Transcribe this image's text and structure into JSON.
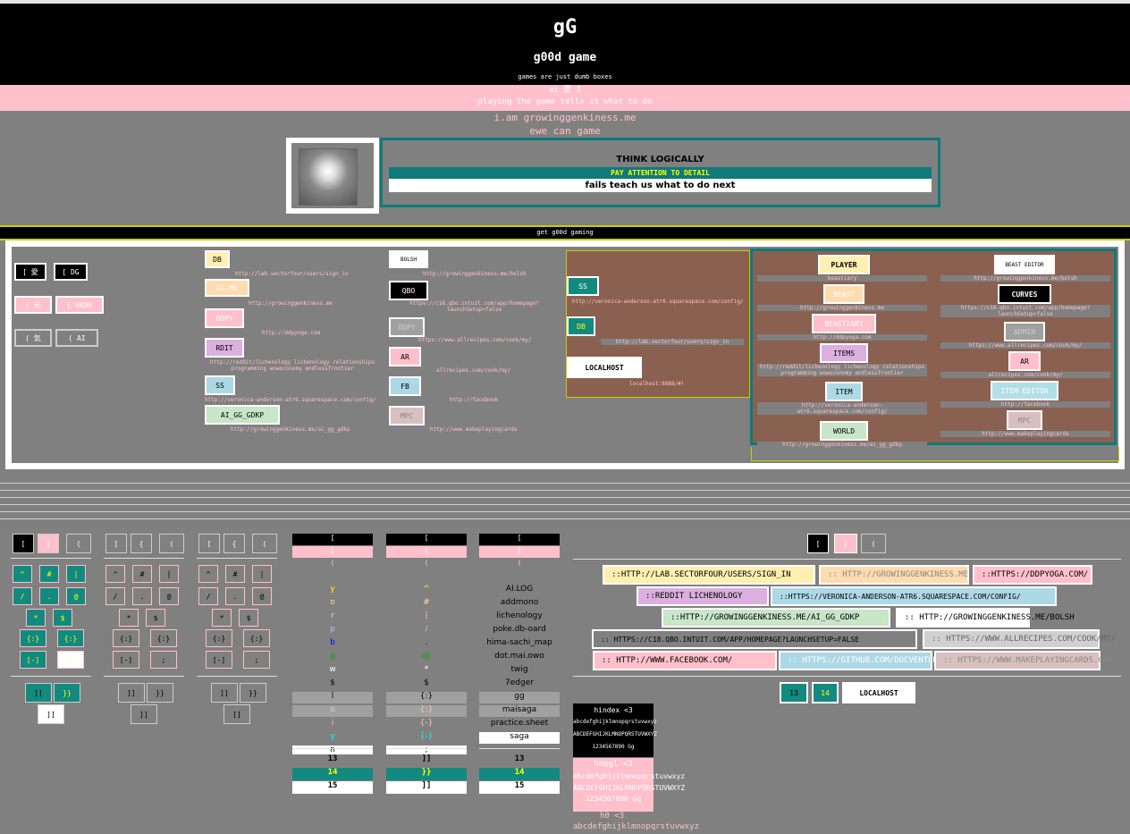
{
  "header": {
    "logo": "gG",
    "name": "g00d game",
    "tagline": "games are just dumb boxes"
  },
  "pinkband": {
    "line1": "ai 愛 I",
    "line2": "playing the game tells it what to do"
  },
  "below": {
    "line1": "i.am growinggenkiness.me",
    "line2": "ewe can game"
  },
  "think": {
    "title": "THINK LOGICALLY",
    "attention": "PAY ATTENTION TO DETAIL",
    "fails": "fails teach us what to do next"
  },
  "ggbar": "get g00d gaming",
  "left_buttons": [
    "[ 愛",
    "[ DG",
    "( 元",
    "[ 0K06",
    "( 気",
    "( AI"
  ],
  "col1": [
    {
      "label": "DB",
      "url": "http://lab.sectorfour/users/sign_in"
    },
    {
      "label": "GG.ME",
      "url": "http://growinggenkiness.me"
    },
    {
      "label": "DDPY",
      "url": "http://ddpyoga.com"
    },
    {
      "label": "RDIT",
      "url": "http://reddit/lichenology lichenology relationships programming wowoconomy endlessfrontier"
    },
    {
      "label": "SS",
      "url": "http://veronica-anderson-atr6.squarespace.com/config/"
    },
    {
      "label": "AI_GG_GDKP",
      "url": "http://growinggenkiness.me/ai_gg_gdkp"
    }
  ],
  "col2": [
    {
      "label": "BOLSH",
      "url": "http://growinggenkiness.me/bolsh"
    },
    {
      "label": "QBO",
      "url": "https://c18.qbo.intuit.com/app/homepage?launchSetup=false"
    },
    {
      "label": "DDPY",
      "url": "https://www.allrecipes.com/cook/my/"
    },
    {
      "label": "AR",
      "url": "allrecipes.com/cook/my/"
    },
    {
      "label": "FB",
      "url": "http://facebook"
    },
    {
      "label": "MPC",
      "url": "http://www.makeplayingcards"
    }
  ],
  "yellowbox": [
    {
      "label": "SS",
      "url": "http://veronica-anderson-atr6.squarespace.com/config/"
    },
    {
      "label": "DB",
      "url": "http://lab.sectorfour/users/sign_in"
    },
    {
      "label": "LOCALHOST",
      "url": "localhost:8888/#!"
    }
  ],
  "tealbox_left": [
    {
      "label": "PLAYER",
      "url": "beastiary"
    },
    {
      "label": "BEAST",
      "url": "http://growinggenkiness.me"
    },
    {
      "label": "BEASTIARY",
      "url": "http://ddpyoga.com"
    },
    {
      "label": "ITEMS",
      "url": "http://reddit/lichenology lichenology relationships programming wowoconomy endlessfrontier"
    },
    {
      "label": "ITEM",
      "url": "http://veronica-anderson-atr6.squarespace.com/config/"
    },
    {
      "label": "WORLD",
      "url": "http://growinggenkiness.me/ai_gg_gdkp"
    }
  ],
  "tealbox_right": [
    {
      "label": "BEAST EDITOR",
      "url": "http://growinggenkiness.me/bolsh"
    },
    {
      "label": "CURVES",
      "url": "https://c18.qbo.intuit.com/app/homepage?launchSetup=false"
    },
    {
      "label": "ADMIN",
      "url": "https://www.allrecipes.com/cook/my/"
    },
    {
      "label": "AR",
      "url": "allrecipes.com/cook/my/"
    },
    {
      "label": "ITEM EDITOR",
      "url": "http://facebook"
    },
    {
      "label": "MPC",
      "url": "http://www.makeplayingcards"
    }
  ],
  "kbd_tabs": [
    "[",
    "[",
    "(",
    "[",
    "{",
    "(",
    "[",
    "{",
    "("
  ],
  "kbd_keys": [
    "^",
    "#",
    "|",
    "/",
    ".",
    "@",
    "*",
    "$",
    "{:}",
    "[-]",
    ";"
  ],
  "kbd_bottom": [
    "]]",
    "}}",
    "]]"
  ],
  "fontcols": [
    {
      "head": [
        "[",
        "[",
        "("
      ],
      "rows": [
        "y",
        "o",
        "r",
        "p",
        "b",
        "g",
        "w",
        "$",
        "l",
        "o",
        "i",
        "y",
        "n"
      ],
      "foot": [
        "13",
        "14",
        "15"
      ]
    },
    {
      "head": [
        "[",
        "{",
        "("
      ],
      "rows": [
        "^",
        "#",
        "|",
        "/",
        ".",
        "@",
        "*",
        "$",
        "{:}",
        "{:}",
        "{-}",
        "{-}",
        ";"
      ],
      "foot": [
        "]]",
        "}}",
        "]]"
      ]
    },
    {
      "head": [
        "[",
        "[",
        "("
      ],
      "rows": [
        "AI.LOG",
        "addmono",
        "lichenology",
        "poke.db-oard",
        "hima-sachi_map",
        "dot.mai.owo",
        "twig",
        "7edger",
        "gg",
        "maisaga",
        "practice.sheet",
        "saga"
      ],
      "foot": [
        "13",
        "14",
        "15"
      ]
    }
  ],
  "right_tabs": [
    "[",
    "[",
    "("
  ],
  "pills": [
    "::HTTP://LAB.SECTORFOUR/USERS/SIGN_IN",
    ":: HTTP://GROWINGGENKINESS.ME",
    "::HTTPS://DDPYOGA.COM/",
    "::REDDIT LICHENOLOGY",
    "::HTTPS://VERONICA-ANDERSON-ATR6.SQUARESPACE.COM/CONFIG/",
    "::HTTP://GROWINGGENKINESS.ME/AI_GG_GDKP",
    ":: HTTP://GROWINGGENKINESS.ME/BOLSH",
    ":: HTTPS://C18.QBO.INTUIT.COM/APP/HOMEPAGE?LAUNCHSETUP=FALSE",
    ":: HTTPS://WWW.ALLRECIPES.COM/COOK/MY/",
    ":: HTTP://WWW.FACEBOOK.COM/",
    ":: HTTPS://GITHUB.COM/DOCVENTUR",
    ":: HTTPS://WWW.MAKEPLAYINGCARDS.COM/"
  ],
  "bottom_buttons": [
    "13",
    "14",
    "LOCALHOST"
  ],
  "samples": {
    "h1": "hindex <3",
    "lower": "abcdefghijklmnopqrstuvwxyz",
    "upper": "ABCDEFGHIJKLMNOPQRSTUVWXYZ",
    "digits": "1234567890 Gg",
    "h2": "hnegl <3",
    "h3": "h0 <3"
  }
}
